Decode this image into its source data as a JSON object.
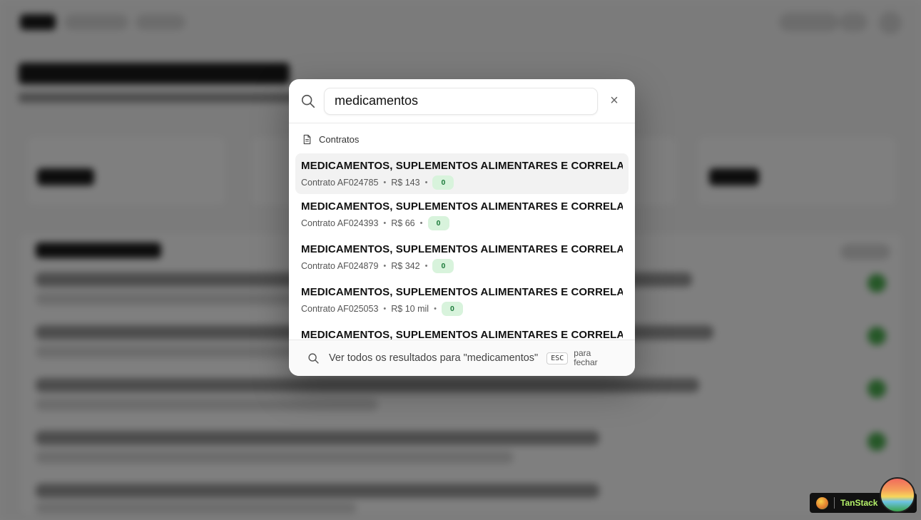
{
  "search": {
    "value": "medicamentos",
    "close_label": "×"
  },
  "group": {
    "label": "Contratos"
  },
  "results": [
    {
      "title": "MEDICAMENTOS, SUPLEMENTOS ALIMENTARES E CORRELATOS...",
      "contract": "Contrato AF024785",
      "value": "R$ 143",
      "badge": "0"
    },
    {
      "title": "MEDICAMENTOS, SUPLEMENTOS ALIMENTARES E CORRELATOS...",
      "contract": "Contrato AF024393",
      "value": "R$ 66",
      "badge": "0"
    },
    {
      "title": "MEDICAMENTOS, SUPLEMENTOS ALIMENTARES E CORRELATOS...",
      "contract": "Contrato AF024879",
      "value": "R$ 342",
      "badge": "0"
    },
    {
      "title": "MEDICAMENTOS, SUPLEMENTOS ALIMENTARES E CORRELATOS...",
      "contract": "Contrato AF025053",
      "value": "R$ 10 mil",
      "badge": "0"
    },
    {
      "title": "MEDICAMENTOS, SUPLEMENTOS ALIMENTARES E CORRELATOS...",
      "contract": "",
      "value": "",
      "badge": ""
    }
  ],
  "footer": {
    "see_all": "Ver todos os resultados para \"medicamentos\"",
    "esc_key": "ESC",
    "esc_hint": "para fechar"
  },
  "devtools": {
    "label": "TanStack"
  },
  "colors": {
    "badge_bg": "#d8f3dc",
    "badge_text": "#1b7a3a",
    "overlay": "rgba(0,0,0,0.5)"
  },
  "icons": [
    "search-icon",
    "close-icon",
    "document-icon",
    "tanstack-logo-icon"
  ]
}
